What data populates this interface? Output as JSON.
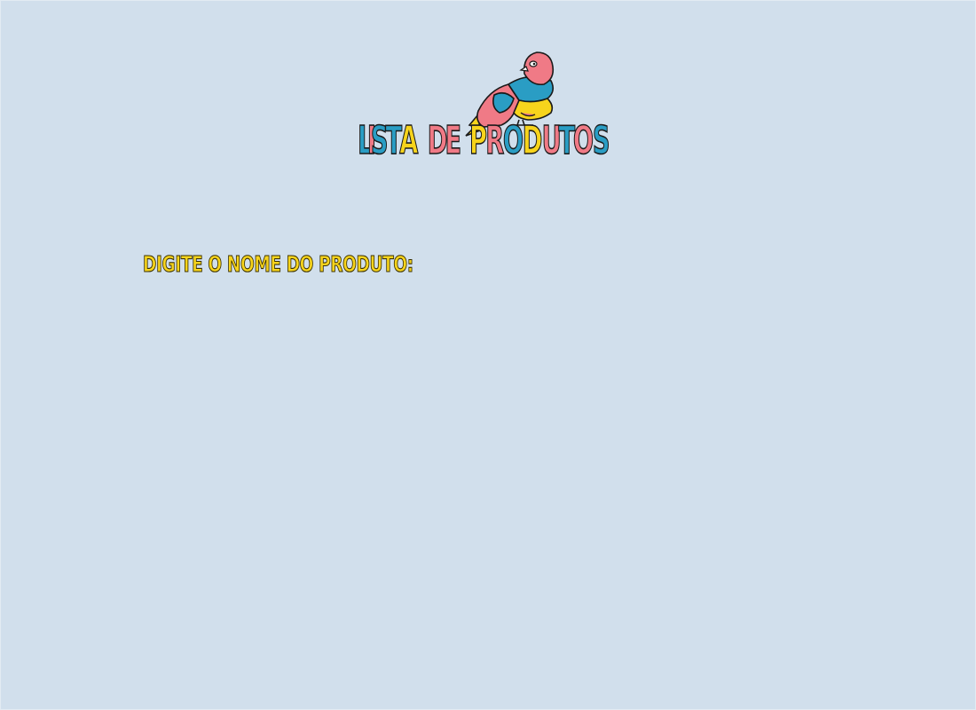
{
  "header": {
    "title": "LISTA DE PRODUTOS",
    "letter_colors": [
      "#2a9dc4",
      "#f07a86",
      "#2a9dc4",
      "#2a9dc4",
      "#f7d41c",
      "#f07a86",
      "#f07a86",
      "#f7d41c",
      "#f07a86",
      "#2a9dc4",
      "#f7d41c",
      "#f07a86",
      "#2a9dc4",
      "#f07a86",
      "#2a9dc4",
      "#f07a86"
    ],
    "logo_icon": "bird-icon"
  },
  "form": {
    "prompt_label": "DIGITE O NOME DO PRODUTO:"
  },
  "colors": {
    "background": "#d1dfec",
    "accent_yellow": "#f7d41c",
    "accent_pink": "#f07a86",
    "accent_blue": "#2a9dc4"
  }
}
